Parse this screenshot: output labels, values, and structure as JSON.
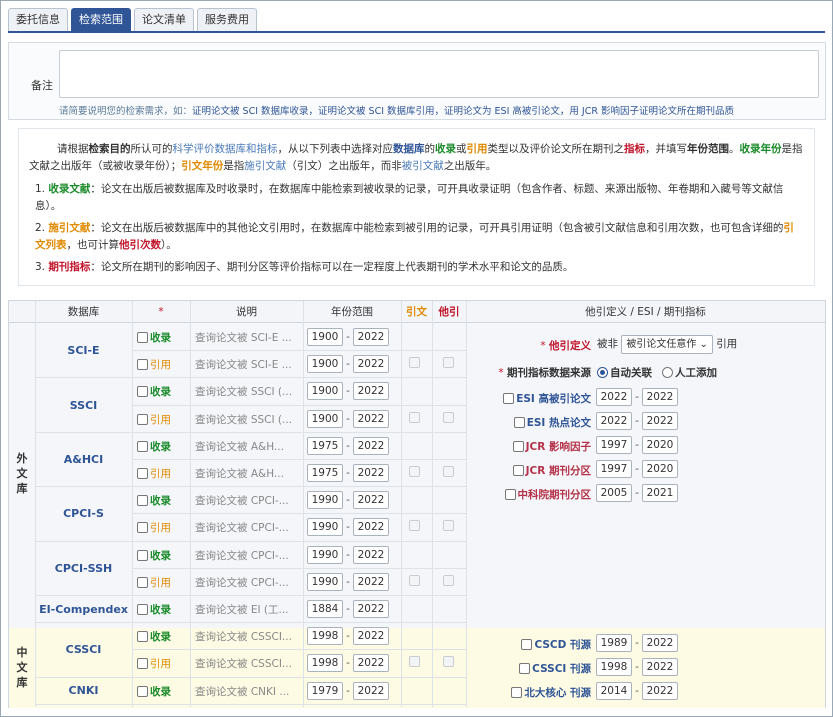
{
  "tabs": [
    "委托信息",
    "检索范围",
    "论文清单",
    "服务费用"
  ],
  "active_tab": 1,
  "remark": {
    "label": "备注",
    "value": "",
    "hint_prefix": "请简要说明您的检索需求，如：",
    "hint_examples": "证明论文被 SCI 数据库收录，证明论文被 SCI 数据库引用，证明论文为 ESI 高被引论文，用 JCR 影响因子证明论文所在期刊品质"
  },
  "info": {
    "p1": "请根据",
    "p2": "检索目的",
    "p3": "所认可的",
    "p4": "科学评价数据库和指标",
    "p5": "，从以下列表中选择对应",
    "p6": "数据库",
    "p7": "的",
    "p8": "收录",
    "p9": "或",
    "p10": "引用",
    "p11": "类型以及评价论文所在期刊之",
    "p12": "指标",
    "p13": "，并填写",
    "p14": "年份范围",
    "p15": "。",
    "p16": "收录年份",
    "p17": "是指文献之出版年（或被收录年份）；",
    "p18": "引文年份",
    "p19": "是指",
    "p20": "施引文献",
    "p21": "（引文）之出版年，而非",
    "p22": "被引文献",
    "p23": "之出版年。",
    "items": [
      {
        "no": "1.",
        "term": "收录文献",
        "text": "：论文在出版后被数据库及时收录时，在数据库中能检索到被收录的记录，可开具收录证明（包含作者、标题、来源出版物、年卷期和入藏号等文献信息）。"
      },
      {
        "no": "2.",
        "term": "施引文献",
        "text_a": "：论文在出版后被数据库中的其他论文引用时，在数据库中能检索到被引用的记录，可开具引用证明（包含被引文献信息和引用次数，也可包含详细的",
        "link": "引文列表",
        "text_b": "，也可计算",
        "hl": "他引次数",
        "text_c": "）。"
      },
      {
        "no": "3.",
        "term": "期刊指标",
        "text": "：论文所在期刊的影响因子、期刊分区等评价指标可以在一定程度上代表期刊的学术水平和论文的品质。"
      }
    ]
  },
  "table": {
    "headers": {
      "db": "数据库",
      "star": "*",
      "desc": "说明",
      "years": "年份范围",
      "cite": "引文",
      "other": "他引",
      "right": "他引定义 / ESI / 期刊指标"
    },
    "groups": {
      "foreign": "外文库",
      "chinese": "中文库"
    },
    "opt_shoulu": "收录",
    "opt_yinyong": "引用",
    "rows": [
      {
        "db": "SCI-E",
        "type": "收录",
        "desc": "查询论文被 SCI-E ...",
        "from": "1900",
        "to": "2022"
      },
      {
        "db": "",
        "type": "引用",
        "desc": "查询论文被 SCI-E ...",
        "from": "1900",
        "to": "2022"
      },
      {
        "db": "SSCI",
        "type": "收录",
        "desc": "查询论文被 SSCI (...",
        "from": "1900",
        "to": "2022"
      },
      {
        "db": "",
        "type": "引用",
        "desc": "查询论文被 SSCI (...",
        "from": "1900",
        "to": "2022"
      },
      {
        "db": "A&HCI",
        "type": "收录",
        "desc": "查询论文被 A&H...",
        "from": "1975",
        "to": "2022"
      },
      {
        "db": "",
        "type": "引用",
        "desc": "查询论文被 A&H...",
        "from": "1975",
        "to": "2022"
      },
      {
        "db": "CPCI-S",
        "type": "收录",
        "desc": "查询论文被 CPCI-...",
        "from": "1990",
        "to": "2022"
      },
      {
        "db": "",
        "type": "引用",
        "desc": "查询论文被 CPCI-...",
        "from": "1990",
        "to": "2022"
      },
      {
        "db": "CPCI-SSH",
        "type": "收录",
        "desc": "查询论文被 CPCI-...",
        "from": "1990",
        "to": "2022"
      },
      {
        "db": "",
        "type": "引用",
        "desc": "查询论文被 CPCI-...",
        "from": "1990",
        "to": "2022"
      },
      {
        "db": "EI-Compendex",
        "type": "收录",
        "desc": "查询论文被 EI (工...",
        "from": "1884",
        "to": "2022"
      },
      {
        "db": "CSSCI",
        "type": "收录",
        "desc": "查询论文被 CSSCI...",
        "from": "1998",
        "to": "2022"
      },
      {
        "db": "",
        "type": "引用",
        "desc": "查询论文被 CSSCI...",
        "from": "1998",
        "to": "2022"
      },
      {
        "db": "CNKI",
        "type": "收录",
        "desc": "查询论文被 CNKI ...",
        "from": "1979",
        "to": "2022"
      }
    ],
    "right": {
      "other_def_label": "他引定义",
      "other_def_prefix": "被非",
      "other_def_select": "被引论文任意作",
      "other_def_suffix": "引用",
      "source_label": "期刊指标数据来源",
      "source_auto": "自动关联",
      "source_manual": "人工添加",
      "metrics": [
        {
          "name": "ESI 高被引论文",
          "color": "#2f5597",
          "from": "2022",
          "to": "2022"
        },
        {
          "name": "ESI 热点论文",
          "color": "#2f5597",
          "from": "2022",
          "to": "2022"
        },
        {
          "name": "JCR 影响因子",
          "color": "#b5334a",
          "from": "1997",
          "to": "2020"
        },
        {
          "name": "JCR 期刊分区",
          "color": "#b5334a",
          "from": "1997",
          "to": "2020"
        },
        {
          "name": "中科院期刊分区",
          "color": "#b5334a",
          "from": "2005",
          "to": "2021"
        }
      ],
      "cn_metrics": [
        {
          "name": "CSCD 刊源",
          "from": "1989",
          "to": "2022"
        },
        {
          "name": "CSSCI 刊源",
          "from": "1998",
          "to": "2022"
        },
        {
          "name": "北大核心 刊源",
          "from": "2014",
          "to": "2022"
        }
      ]
    }
  }
}
